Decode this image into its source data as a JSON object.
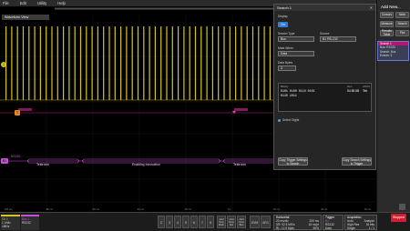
{
  "menu": [
    "File",
    "Edit",
    "Utility",
    "Help"
  ],
  "waveform_view": {
    "title": "Waveform View"
  },
  "channel_labels": {
    "ch1": "1",
    "bus": "B1",
    "bus_name": "RS232",
    "trigger_t": "T"
  },
  "bus_decode": [
    {
      "text": "Tektronix"
    },
    {
      "text": "Enabling Innovation"
    },
    {
      "text": "Tektronix"
    }
  ],
  "search_panel": {
    "title": "Search 1",
    "display_label": "Display",
    "display_value": "On",
    "search_type_label": "Search Type",
    "search_type": "Bus",
    "source_label": "Source",
    "source": "B1 RS-232",
    "mark_when_label": "Mark When",
    "mark_when": "Data",
    "data_bytes_label": "Data Bytes",
    "data_bytes": "3",
    "binary_label": "Binary",
    "binary_line1": "0101 0100 0110 0101",
    "binary_line2": "0110 1011",
    "hex_label": "Hex",
    "hex_value": "54 65 6B",
    "ascii_label": "ASCII",
    "ascii_value": "Tek",
    "select_digits": "Select Digits",
    "copy_trigger_btn": "Copy Trigger Settings to Search",
    "copy_search_btn": "Copy Search Settings to Trigger"
  },
  "right_panel": {
    "title": "Add New...",
    "buttons": [
      "Cursors",
      "Note",
      "Measure",
      "Search",
      "Results Table",
      "Plot"
    ],
    "search_list": [
      "Search 1",
      "Bus: RS232",
      "Search: Bus",
      "Events: 3"
    ]
  },
  "bottom_bar": {
    "ch1_label": "Ch 1",
    "ch1_scale": "1 V/div",
    "ch1_bw": "1MHz",
    "b1_label": "Bus 1",
    "b1_name": "RS232",
    "channels": [
      "2",
      "3",
      "4",
      "5",
      "6",
      "7",
      "8"
    ],
    "add_new": [
      "Add New Math",
      "Add New Ref",
      "Add New Bus"
    ],
    "dvm": "DVM",
    "afg": "AFG",
    "horizontal_label": "Horizontal",
    "horizontal_line1": "20 ms/div",
    "horizontal_line2": "SR: 62.5 MS/s",
    "horizontal_line3": "RL: 12.5 Mpts",
    "horizontal_right1": "200 ms",
    "horizontal_right2": "16 ns/pt",
    "horizontal_right3": "50%",
    "trigger_label": "Trigger",
    "trigger_line1": "B1",
    "trigger_line2": "RS232 Data",
    "acq_label": "Acquisition",
    "acq_line1": "Auto,",
    "acq_line2": "High Res",
    "acq_line3": "Single",
    "acq_right1": "Analyze",
    "acq_right2": "16 bits",
    "acq_right3": "1 / 1",
    "stop": "Stopped"
  }
}
